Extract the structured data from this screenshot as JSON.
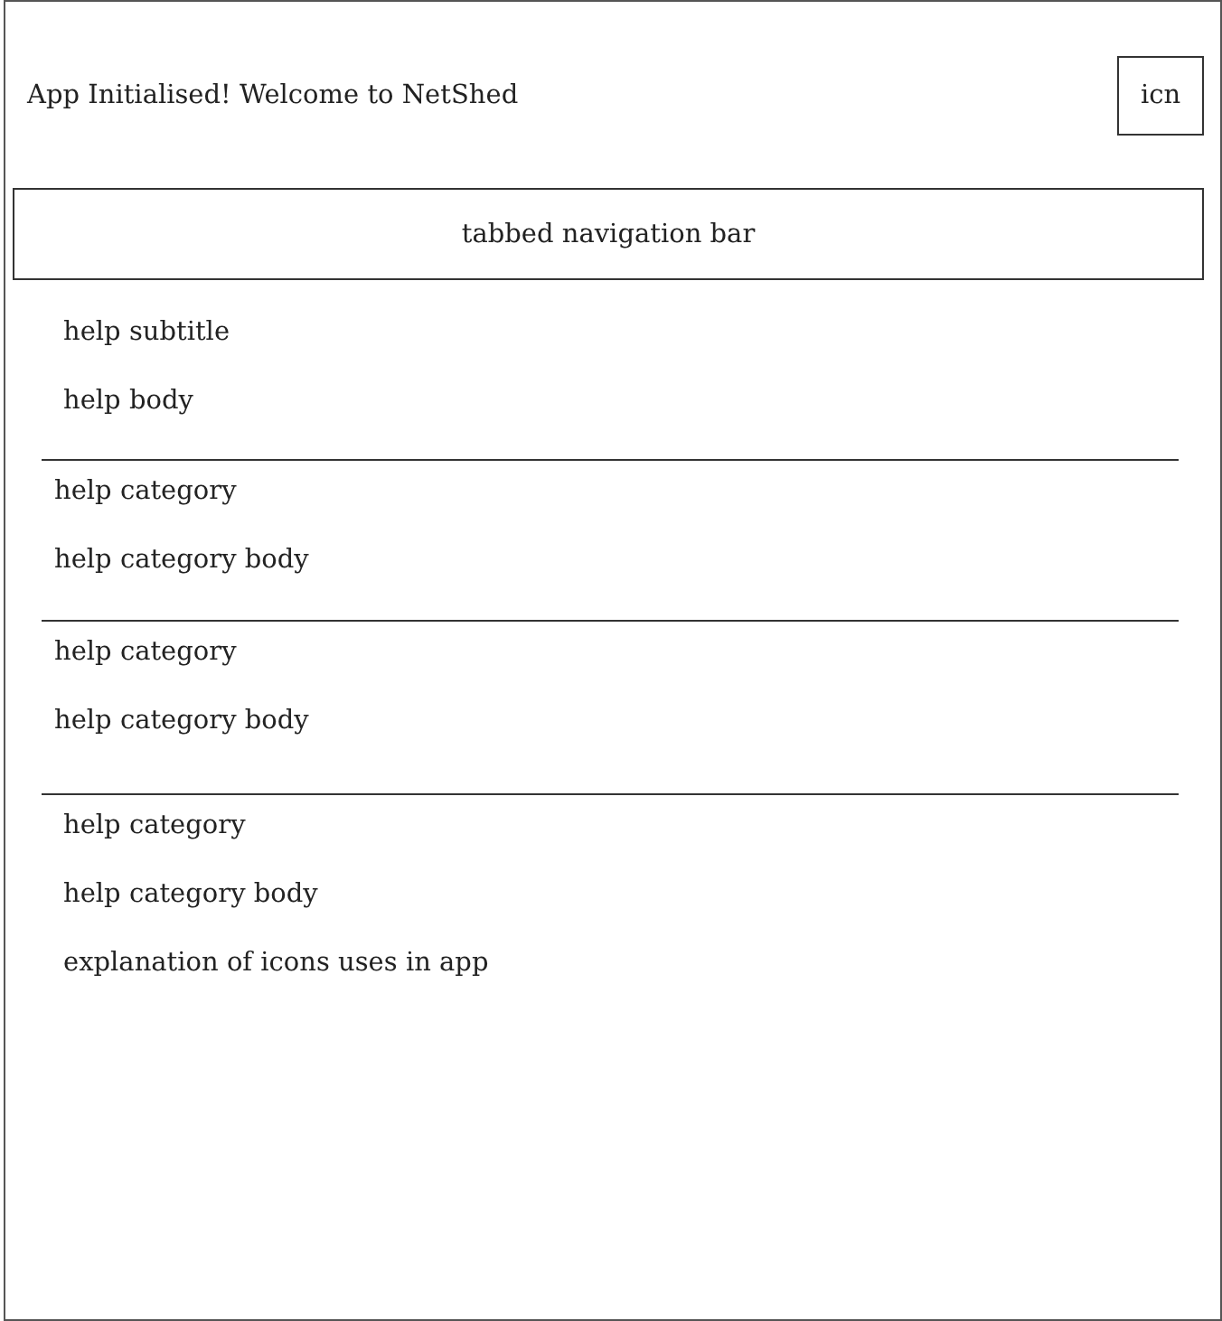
{
  "header": {
    "title": "App Initialised! Welcome to NetShed",
    "icon_label": "icn"
  },
  "navigation": {
    "label": "tabbed navigation bar"
  },
  "intro": {
    "subtitle": "help subtitle",
    "body": "help body"
  },
  "categories": [
    {
      "title": "help category",
      "body": "help category body"
    },
    {
      "title": "help category",
      "body": "help category body"
    },
    {
      "title": "help category",
      "body": "help category body"
    }
  ],
  "icons_explanation": "explanation of icons uses in app"
}
